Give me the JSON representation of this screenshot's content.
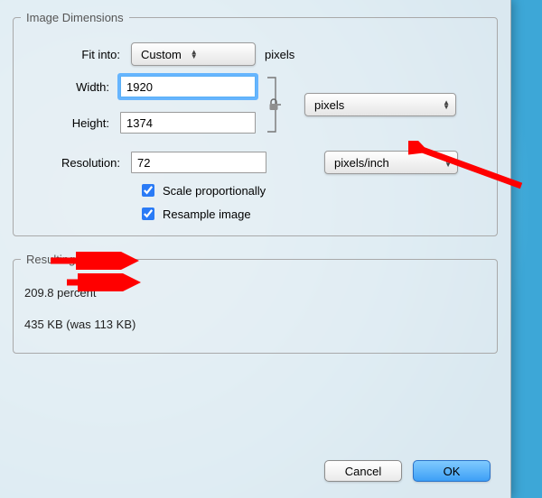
{
  "imageDimensions": {
    "legend": "Image Dimensions",
    "fitInto": {
      "label": "Fit into:",
      "value": "Custom",
      "unit": "pixels"
    },
    "width": {
      "label": "Width:",
      "value": "1920"
    },
    "height": {
      "label": "Height:",
      "value": "1374"
    },
    "sizeUnit": "pixels",
    "resolution": {
      "label": "Resolution:",
      "value": "72",
      "unit": "pixels/inch"
    },
    "scaleProportionally": {
      "label": "Scale proportionally",
      "checked": true
    },
    "resampleImage": {
      "label": "Resample image",
      "checked": true
    }
  },
  "resultingSize": {
    "legend": "Resulting Size",
    "percent": "209.8 percent",
    "fileSize": "435 KB (was 113 KB)"
  },
  "buttons": {
    "cancel": "Cancel",
    "ok": "OK"
  }
}
